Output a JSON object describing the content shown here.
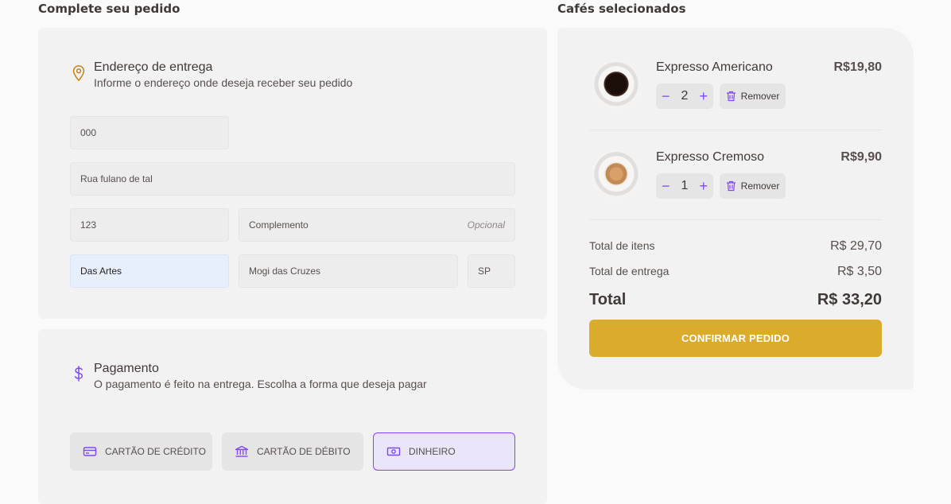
{
  "order": {
    "title": "Complete seu pedido",
    "address": {
      "title": "Endereço de entrega",
      "subtitle": "Informe o endereço onde deseja receber seu pedido",
      "cep": "000",
      "street": "Rua fulano de tal",
      "number": "123",
      "complement_placeholder": "Complemento",
      "complement_optional": "Opcional",
      "neighborhood": "Das Artes",
      "city": "Mogi das Cruzes",
      "uf": "SP"
    },
    "payment": {
      "title": "Pagamento",
      "subtitle": "O pagamento é feito na entrega. Escolha a forma que deseja pagar",
      "options": [
        {
          "label": "CARTÃO DE CRÉDITO",
          "icon": "credit-card-icon"
        },
        {
          "label": "CARTÃO DE DÉBITO",
          "icon": "bank-icon"
        },
        {
          "label": "DINHEIRO",
          "icon": "money-icon",
          "selected": true
        }
      ]
    }
  },
  "cart": {
    "title": "Cafés selecionados",
    "items": [
      {
        "name": "Expresso Americano",
        "price": "R$19,80",
        "qty": "2",
        "remove": "Remover"
      },
      {
        "name": "Expresso Cremoso",
        "price": "R$9,90",
        "qty": "1",
        "remove": "Remover"
      }
    ],
    "summary": {
      "items_label": "Total de itens",
      "items_value": "R$ 29,70",
      "delivery_label": "Total de entrega",
      "delivery_value": "R$ 3,50",
      "total_label": "Total",
      "total_value": "R$ 33,20"
    },
    "confirm": "CONFIRMAR PEDIDO"
  },
  "colors": {
    "accent": "#8047f8",
    "yellow": "#dbac2c",
    "card": "#f3f2f2"
  }
}
